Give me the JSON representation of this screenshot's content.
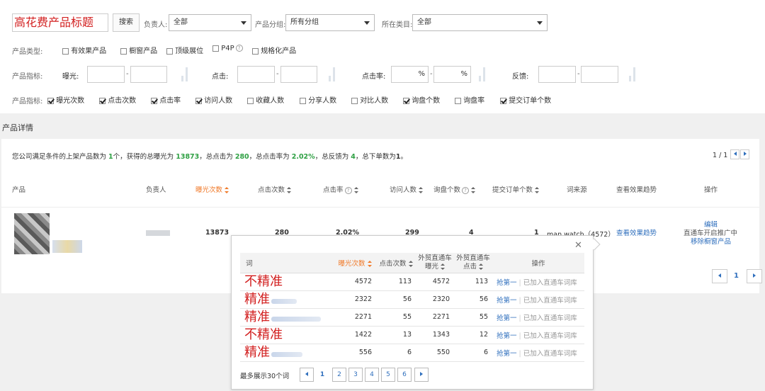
{
  "filters": {
    "title_value": "高花费产品标题",
    "search_button": "搜索",
    "owner_label": "负责人:",
    "owner_value": "全部",
    "group_label": "产品分组:",
    "group_value": "所有分组",
    "category_label": "所在类目:",
    "category_value": "全部",
    "type_label": "产品类型:",
    "types": [
      {
        "label": "有效果产品",
        "checked": false
      },
      {
        "label": "橱窗产品",
        "checked": false
      },
      {
        "label": "顶级展位",
        "checked": false
      },
      {
        "label": "P4P",
        "checked": false
      },
      {
        "label": "规格化产品",
        "checked": false
      }
    ],
    "metric_label": "产品指标:",
    "ranges": [
      {
        "label": "曝光:"
      },
      {
        "label": "点击:"
      },
      {
        "label": "点击率:",
        "unit": "%"
      },
      {
        "label": "反馈:"
      }
    ],
    "range_dash": "-",
    "columns_label": "产品指标:",
    "columns": [
      {
        "label": "曝光次数",
        "checked": true
      },
      {
        "label": "点击次数",
        "checked": true
      },
      {
        "label": "点击率",
        "checked": true
      },
      {
        "label": "访问人数",
        "checked": true
      },
      {
        "label": "收藏人数",
        "checked": false
      },
      {
        "label": "分享人数",
        "checked": false
      },
      {
        "label": "对比人数",
        "checked": false
      },
      {
        "label": "询盘个数",
        "checked": true
      },
      {
        "label": "询盘率",
        "checked": false
      },
      {
        "label": "提交订单个数",
        "checked": true
      }
    ]
  },
  "section_title": "产品详情",
  "summary": {
    "p1": "您公司满足条件的上架产品数为",
    "n1": "1",
    "p2": "个，获得的总曝光为",
    "n2": "13873",
    "p3": "，总点击为",
    "n3": "280",
    "p4": "，总点击率为",
    "n4": "2.02%",
    "p5": "，总反馈为",
    "n5": "4",
    "p6": "，总下单数为",
    "n6": "1",
    "p7": "。"
  },
  "pager_top": "1 / 1",
  "table": {
    "headers": [
      "产品",
      "负责人",
      "曝光次数",
      "点击次数",
      "点击率",
      "访问人数",
      "询盘个数",
      "提交订单个数",
      "词来源",
      "查看效果趋势",
      "操作"
    ],
    "row": {
      "exposure": "13873",
      "clicks": "280",
      "ctr": "2.02%",
      "visitors": "299",
      "inquiries": "4",
      "orders": "1",
      "keyword_source": "man watch（4572）",
      "trend_link": "查看效果趋势",
      "op_edit": "编辑",
      "op_status": "直通车开启推广中",
      "op_remove": "移除橱窗产品"
    }
  },
  "pager_bottom": "1",
  "popup": {
    "close": "✕",
    "headers": {
      "word": "词",
      "exposure": "曝光次数",
      "clicks": "点击次数",
      "p4p_exposure_l1": "外贸直通车",
      "p4p_exposure_l2": "曝光",
      "p4p_clicks_l1": "外贸直通车",
      "p4p_clicks_l2": "点击",
      "op": "操作"
    },
    "rows": [
      {
        "word": "不精准",
        "exposure": "4572",
        "clicks": "113",
        "p4p_exposure": "4572",
        "p4p_clicks": "113"
      },
      {
        "word": "精准",
        "exposure": "2322",
        "clicks": "56",
        "p4p_exposure": "2320",
        "p4p_clicks": "56"
      },
      {
        "word": "精准",
        "exposure": "2271",
        "clicks": "55",
        "p4p_exposure": "2271",
        "p4p_clicks": "55"
      },
      {
        "word": "不精准",
        "exposure": "1422",
        "clicks": "13",
        "p4p_exposure": "1343",
        "p4p_clicks": "12"
      },
      {
        "word": "精准",
        "exposure": "556",
        "clicks": "6",
        "p4p_exposure": "550",
        "p4p_clicks": "6"
      }
    ],
    "op_grab": "抢第一",
    "op_sep": "|",
    "op_added": "已加入直通车词库",
    "max_note": "最多展示30个词",
    "pages": [
      "1",
      "2",
      "3",
      "4",
      "5",
      "6"
    ]
  }
}
